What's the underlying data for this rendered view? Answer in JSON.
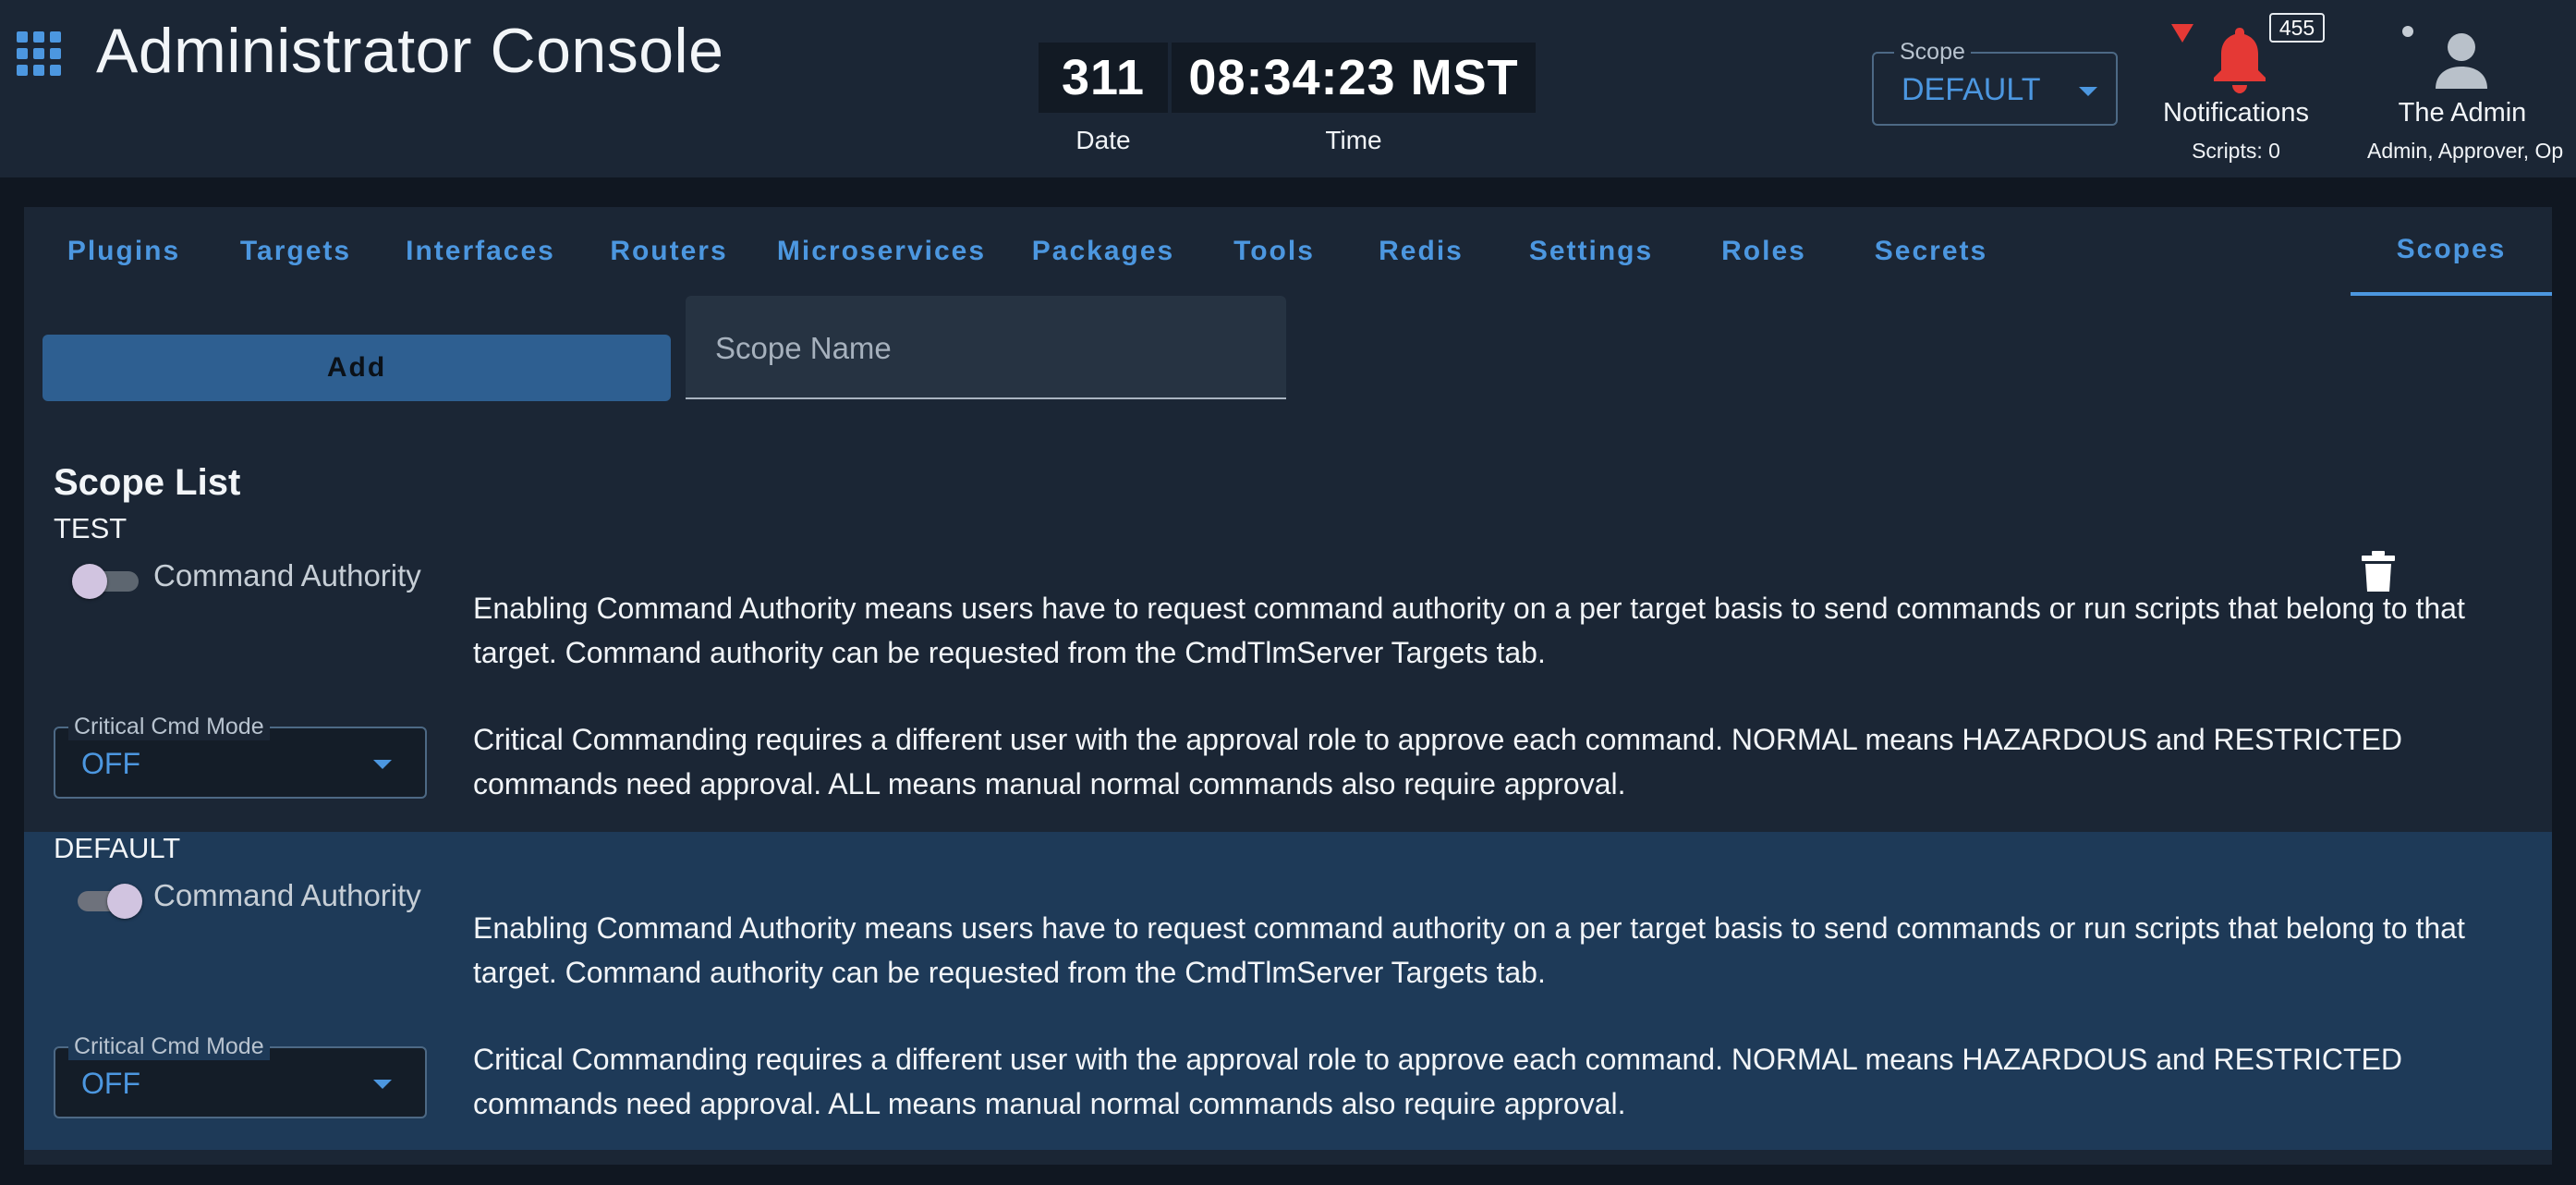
{
  "header": {
    "title": "Administrator Console",
    "clock": {
      "date_value": "311",
      "time_value": "08:34:23 MST",
      "date_label": "Date",
      "time_label": "Time"
    },
    "scope_selector": {
      "label": "Scope",
      "value": "DEFAULT"
    },
    "notifications": {
      "count": "455",
      "label": "Notifications",
      "scripts": "Scripts: 0"
    },
    "user": {
      "name": "The Admin",
      "roles": "Admin, Approver, Op"
    }
  },
  "tabs": [
    {
      "label": "Plugins"
    },
    {
      "label": "Targets"
    },
    {
      "label": "Interfaces"
    },
    {
      "label": "Routers"
    },
    {
      "label": "Microservices"
    },
    {
      "label": "Packages"
    },
    {
      "label": "Tools"
    },
    {
      "label": "Redis"
    },
    {
      "label": "Settings"
    },
    {
      "label": "Roles"
    },
    {
      "label": "Secrets"
    },
    {
      "label": "Scopes"
    }
  ],
  "active_tab": "Scopes",
  "form": {
    "add_label": "Add",
    "scope_name_placeholder": "Scope Name"
  },
  "scope_list": {
    "title": "Scope List",
    "items": [
      {
        "name": "TEST",
        "command_authority_label": "Command Authority",
        "command_authority_on": false,
        "command_authority_desc": "Enabling Command Authority means users have to request command authority on a per target basis to send commands or run scripts that belong to that target. Command authority can be requested from the CmdTlmServer Targets tab.",
        "critical_mode_label": "Critical Cmd Mode",
        "critical_mode_value": "OFF",
        "critical_mode_desc": "Critical Commanding requires a different user with the approval role to approve each command. NORMAL means HAZARDOUS and RESTRICTED commands need approval. ALL means manual normal commands also require approval."
      },
      {
        "name": "DEFAULT",
        "command_authority_label": "Command Authority",
        "command_authority_on": true,
        "command_authority_desc": "Enabling Command Authority means users have to request command authority on a per target basis to send commands or run scripts that belong to that target. Command authority can be requested from the CmdTlmServer Targets tab.",
        "critical_mode_label": "Critical Cmd Mode",
        "critical_mode_value": "OFF",
        "critical_mode_desc": "Critical Commanding requires a different user with the approval role to approve each command. NORMAL means HAZARDOUS and RESTRICTED commands need approval. ALL means manual normal commands also require approval."
      }
    ]
  },
  "colors": {
    "accent": "#4c97e0",
    "background": "#101721",
    "surface": "#1b2635",
    "selected_row": "#1e3a58",
    "alert": "#e53935"
  },
  "icons": [
    "apps-grid-icon",
    "bell-icon",
    "user-icon",
    "trash-icon",
    "chevron-down-icon"
  ]
}
